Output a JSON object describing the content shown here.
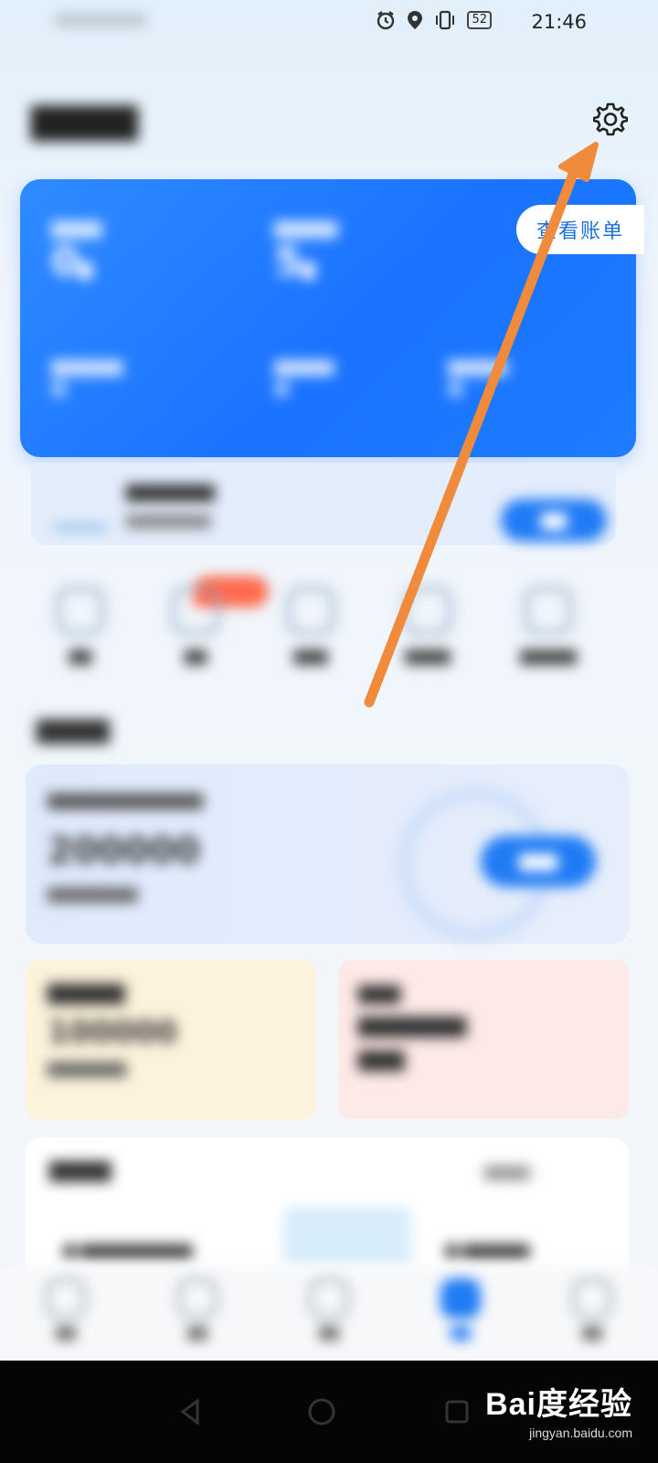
{
  "status_bar": {
    "time": "21:46",
    "battery": "52",
    "icons": [
      "alarm-icon",
      "location-icon",
      "vibrate-icon",
      "battery-icon"
    ]
  },
  "header": {
    "settings_icon": "gear-icon"
  },
  "quota_card": {
    "bill_button_label": "查看账单"
  },
  "bottom_nav": {
    "items": [
      {
        "icon": "home-icon"
      },
      {
        "icon": "car-icon"
      },
      {
        "icon": "chat-icon"
      },
      {
        "icon": "wallet-icon"
      },
      {
        "icon": "profile-icon"
      }
    ]
  },
  "watermark": {
    "logo": "Bai度经验",
    "url": "jingyan.baidu.com"
  },
  "colors": {
    "card_blue": "#1a73ff",
    "arrow_orange": "#f08a3c",
    "promo_button": "#1f7bf5"
  }
}
